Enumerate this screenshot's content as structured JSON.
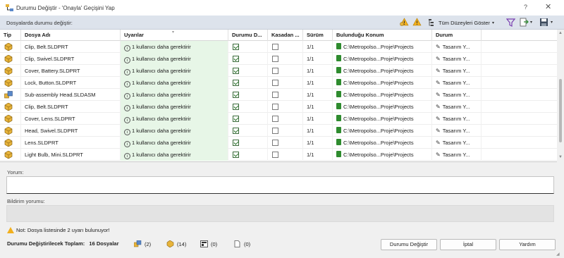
{
  "window": {
    "title": "Durumu Değiştir - 'Onayla' Geçişini Yap",
    "help_glyph": "?",
    "close_glyph": "✕"
  },
  "toolbar": {
    "label": "Dosyalarda durumu değiştir:",
    "levels_label": "Tüm Düzeyleri Göster",
    "caret": "▾"
  },
  "grid": {
    "columns": [
      "Tip",
      "Dosya Adı",
      "Uyarılar",
      "Durumu D...",
      "Kasadan ...",
      "Sürüm",
      "Bulunduğu Konum",
      "Durum"
    ],
    "sort_caret": "▾",
    "rows": [
      {
        "type": "part",
        "name": "Clip, Belt.SLDPRT",
        "warning": "1 kullanıcı daha gerektirir",
        "change": true,
        "vault": false,
        "version": "1/1",
        "location": "C:\\Metropolso...Proje\\Projects",
        "state": "Tasarım Y..."
      },
      {
        "type": "part",
        "name": "Clip, Swivel.SLDPRT",
        "warning": "1 kullanıcı daha gerektirir",
        "change": true,
        "vault": false,
        "version": "1/1",
        "location": "C:\\Metropolso...Proje\\Projects",
        "state": "Tasarım Y..."
      },
      {
        "type": "part",
        "name": "Cover, Battery.SLDPRT",
        "warning": "1 kullanıcı daha gerektirir",
        "change": true,
        "vault": false,
        "version": "1/1",
        "location": "C:\\Metropolso...Proje\\Projects",
        "state": "Tasarım Y..."
      },
      {
        "type": "part",
        "name": "Lock, Button.SLDPRT",
        "warning": "1 kullanıcı daha gerektirir",
        "change": true,
        "vault": false,
        "version": "1/1",
        "location": "C:\\Metropolso...Proje\\Projects",
        "state": "Tasarım Y..."
      },
      {
        "type": "assembly",
        "name": "Sub-assembly Head.SLDASM",
        "warning": "1 kullanıcı daha gerektirir",
        "change": true,
        "vault": false,
        "version": "1/1",
        "location": "C:\\Metropolso...Proje\\Projects",
        "state": "Tasarım Y..."
      },
      {
        "type": "part",
        "name": "Clip, Belt.SLDPRT",
        "warning": "1 kullanıcı daha gerektirir",
        "change": true,
        "vault": false,
        "version": "1/1",
        "location": "C:\\Metropolso...Proje\\Projects",
        "state": "Tasarım Y..."
      },
      {
        "type": "part",
        "name": "Cover, Lens.SLDPRT",
        "warning": "1 kullanıcı daha gerektirir",
        "change": true,
        "vault": false,
        "version": "1/1",
        "location": "C:\\Metropolso...Proje\\Projects",
        "state": "Tasarım Y..."
      },
      {
        "type": "part",
        "name": "Head, Swivel.SLDPRT",
        "warning": "1 kullanıcı daha gerektirir",
        "change": true,
        "vault": false,
        "version": "1/1",
        "location": "C:\\Metropolso...Proje\\Projects",
        "state": "Tasarım Y..."
      },
      {
        "type": "part",
        "name": "Lens.SLDPRT",
        "warning": "1 kullanıcı daha gerektirir",
        "change": true,
        "vault": false,
        "version": "1/1",
        "location": "C:\\Metropolso...Proje\\Projects",
        "state": "Tasarım Y..."
      },
      {
        "type": "part",
        "name": "Light Bulb, Mini.SLDPRT",
        "warning": "1 kullanıcı daha gerektirir",
        "change": true,
        "vault": false,
        "version": "1/1",
        "location": "C:\\Metropolso...Proje\\Projects",
        "state": "Tasarım Y..."
      }
    ]
  },
  "comment": {
    "label": "Yorum:",
    "value": ""
  },
  "notification": {
    "label": "Bildirim yorumu:",
    "value": ""
  },
  "note": "Not: Dosya listesinde 2 uyarı bulunuyor!",
  "summary": {
    "label": "Durumu Değiştirilecek Toplam:",
    "total": "16 Dosyalar",
    "assemblies": "(2)",
    "parts": "(14)",
    "drawings": "(0)",
    "other": "(0)"
  },
  "buttons": {
    "change_state": "Durumu Değiştir",
    "cancel": "İptal",
    "help": "Yardım"
  },
  "colors": {
    "warning_cell": "#e7f6e7",
    "toolbar_bg": "#dde3ec",
    "folder_green": "#2e8b2e",
    "part_gold": "#e8b43a",
    "assembly_blue": "#5a88c9"
  }
}
